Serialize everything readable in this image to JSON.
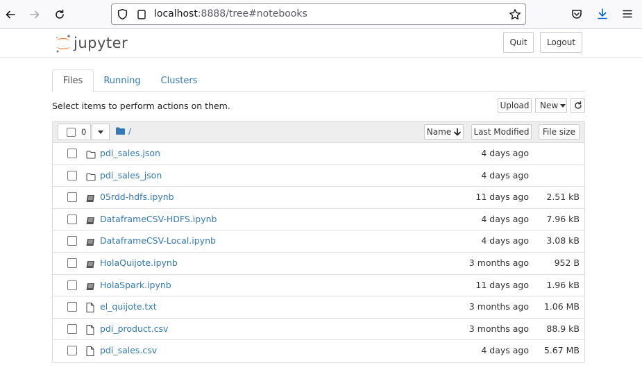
{
  "browser": {
    "url_host": "localhost",
    "url_rest": ":8888/tree#notebooks"
  },
  "header": {
    "logo_text": "jupyter",
    "quit_label": "Quit",
    "logout_label": "Logout"
  },
  "tabs": [
    {
      "label": "Files",
      "active": true
    },
    {
      "label": "Running",
      "active": false
    },
    {
      "label": "Clusters",
      "active": false
    }
  ],
  "toolbar": {
    "hint": "Select items to perform actions on them.",
    "upload_label": "Upload",
    "new_label": "New",
    "refresh_icon": "refresh-icon"
  },
  "list_header": {
    "selected_count": "0",
    "path": "/",
    "col_name": "Name",
    "col_modified": "Last Modified",
    "col_size": "File size"
  },
  "items": [
    {
      "type": "folder",
      "name": "pdi_sales.json",
      "modified": "4 days ago",
      "size": ""
    },
    {
      "type": "folder",
      "name": "pdi_sales_json",
      "modified": "4 days ago",
      "size": ""
    },
    {
      "type": "notebook",
      "name": "05rdd-hdfs.ipynb",
      "modified": "11 days ago",
      "size": "2.51 kB"
    },
    {
      "type": "notebook",
      "name": "DataframeCSV-HDFS.ipynb",
      "modified": "4 days ago",
      "size": "7.96 kB"
    },
    {
      "type": "notebook",
      "name": "DataframeCSV-Local.ipynb",
      "modified": "4 days ago",
      "size": "3.08 kB"
    },
    {
      "type": "notebook",
      "name": "HolaQuijote.ipynb",
      "modified": "3 months ago",
      "size": "952 B"
    },
    {
      "type": "notebook",
      "name": "HolaSpark.ipynb",
      "modified": "11 days ago",
      "size": "1.96 kB"
    },
    {
      "type": "file",
      "name": "el_quijote.txt",
      "modified": "3 months ago",
      "size": "1.06 MB"
    },
    {
      "type": "file",
      "name": "pdi_product.csv",
      "modified": "3 months ago",
      "size": "88.9 kB"
    },
    {
      "type": "file",
      "name": "pdi_sales.csv",
      "modified": "4 days ago",
      "size": "5.67 MB"
    }
  ]
}
